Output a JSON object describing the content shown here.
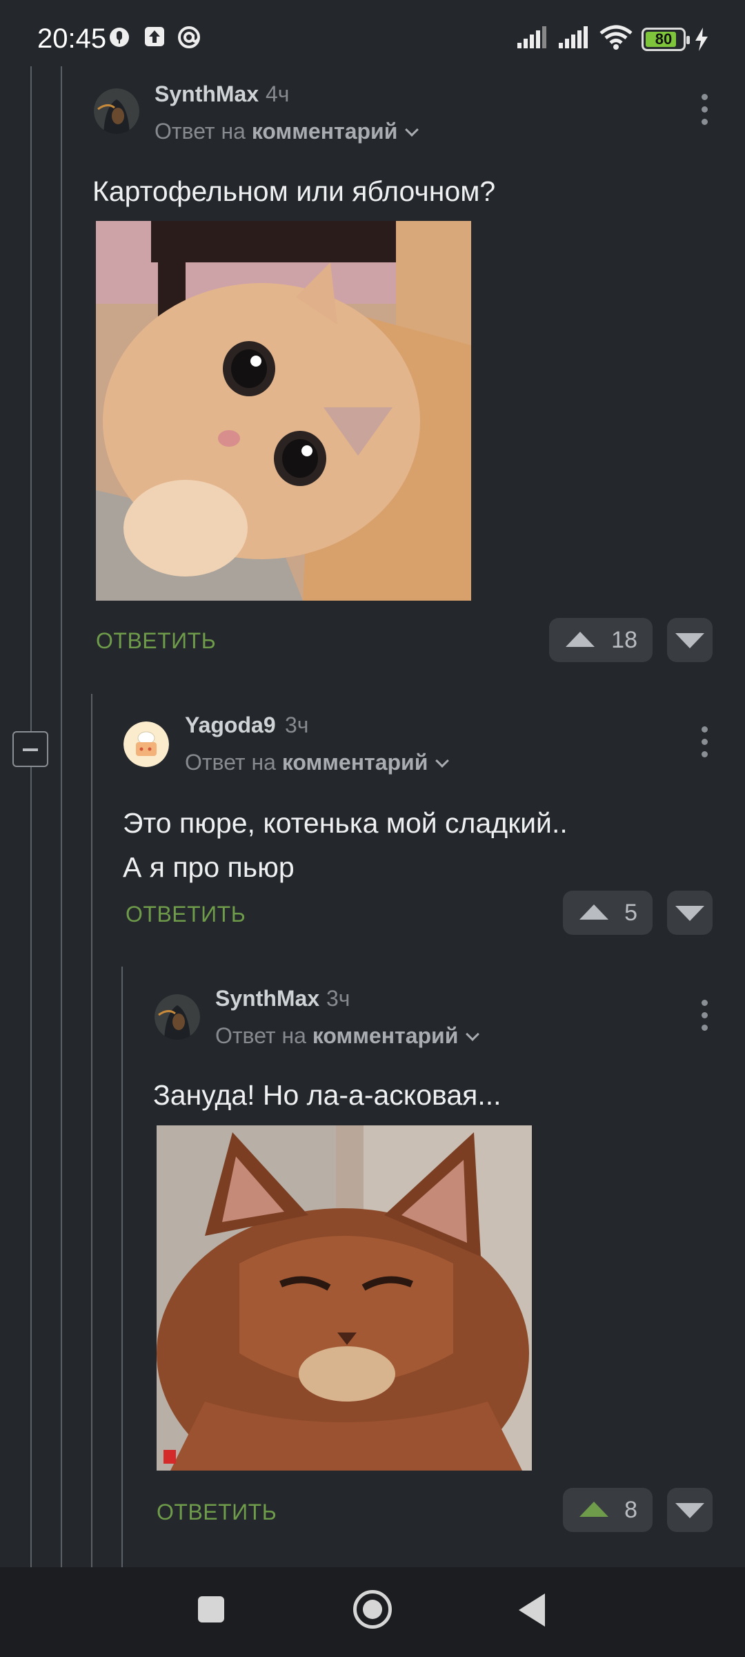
{
  "status_bar": {
    "time": "20:45",
    "battery": "80"
  },
  "comments": [
    {
      "author": "SynthMax",
      "time": "4ч",
      "reply_prefix": "Ответ на",
      "reply_target": "комментарий",
      "text_lines": [
        "Картофельном или яблочном?"
      ],
      "image": "photo of a ginger kitten with big round eyes",
      "reply_label": "ОТВЕТИТЬ",
      "votes": "18"
    },
    {
      "author": "Yagoda9",
      "time": "3ч",
      "reply_prefix": "Ответ на",
      "reply_target": "комментарий",
      "text_lines": [
        "Это пюре, котенька мой сладкий..",
        "А я про пьюр"
      ],
      "reply_label": "ОТВЕТИТЬ",
      "votes": "5"
    },
    {
      "author": "SynthMax",
      "time": "3ч",
      "reply_prefix": "Ответ на",
      "reply_target": "комментарий",
      "text_lines": [
        "Зануда! Но ла-а-асковая..."
      ],
      "image": "photo of a tabby cat with a smug face",
      "reply_label": "ОТВЕТИТЬ",
      "votes": "8"
    }
  ],
  "colors": {
    "background": "#24272b",
    "accent": "#6e9c4a",
    "vote_bg": "#393d42"
  },
  "icons": [
    "mic-icon",
    "upload-icon",
    "at-icon",
    "signal-icon",
    "wifi-icon",
    "battery-icon",
    "charging-icon",
    "collapse-icon",
    "more-icon",
    "upvote-icon",
    "downvote-icon",
    "nav-recents-icon",
    "nav-home-icon",
    "nav-back-icon"
  ]
}
